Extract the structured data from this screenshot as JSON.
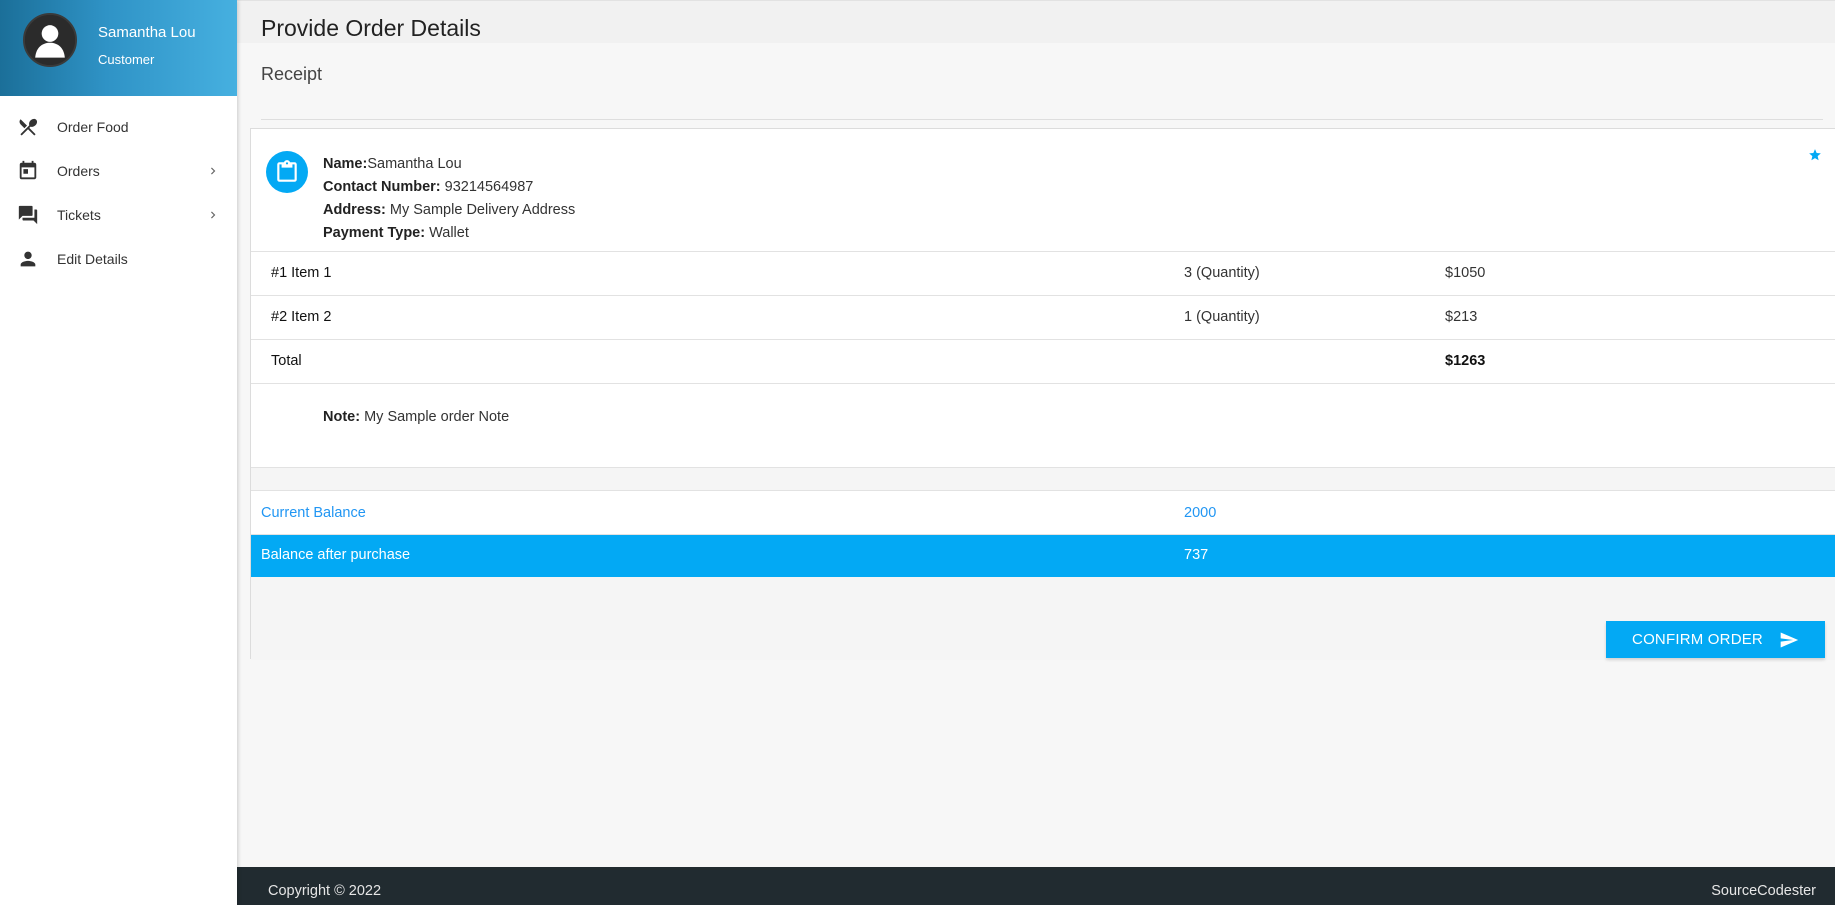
{
  "user": {
    "name": "Samantha Lou",
    "role": "Customer"
  },
  "nav": {
    "items": [
      {
        "label": "Order Food",
        "icon": "utensils-icon",
        "has_submenu": false
      },
      {
        "label": "Orders",
        "icon": "calendar-icon",
        "has_submenu": true
      },
      {
        "label": "Tickets",
        "icon": "chat-icon",
        "has_submenu": true
      },
      {
        "label": "Edit Details",
        "icon": "person-icon",
        "has_submenu": false
      }
    ]
  },
  "page": {
    "title": "Provide Order Details",
    "section": "Receipt"
  },
  "receipt": {
    "name_label": "Name:",
    "name": "Samantha Lou",
    "contact_label": "Contact Number:",
    "contact": "93214564987",
    "address_label": "Address:",
    "address": "My Sample Delivery Address",
    "payment_label": "Payment Type:",
    "payment": "Wallet",
    "items": [
      {
        "name": "#1 Item 1",
        "quantity": "3 (Quantity)",
        "price": "$1050"
      },
      {
        "name": "#2 Item 2",
        "quantity": "1 (Quantity)",
        "price": "$213"
      }
    ],
    "total_label": "Total",
    "total": "$1263",
    "note_label": "Note:",
    "note": "My Sample order Note"
  },
  "balance": {
    "current_label": "Current Balance",
    "current": "2000",
    "after_label": "Balance after purchase",
    "after": "737"
  },
  "actions": {
    "confirm_label": "CONFIRM ORDER"
  },
  "footer": {
    "copyright": "Copyright © 2022",
    "brand": "SourceCodester"
  },
  "colors": {
    "accent": "#03a9f4",
    "link": "#2196f3",
    "footer_bg": "#212b30"
  }
}
